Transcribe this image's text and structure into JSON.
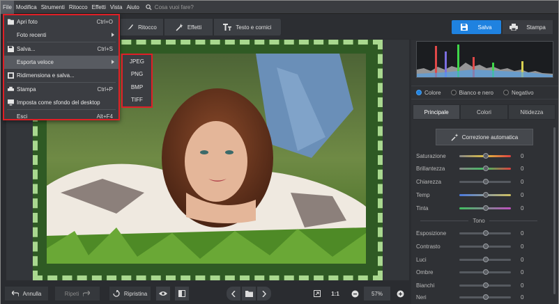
{
  "menubar": {
    "items": [
      "File",
      "Modifica",
      "Strumenti",
      "Ritocco",
      "Effetti",
      "Vista",
      "Aiuto"
    ],
    "search_placeholder": "Cosa vuoi fare?"
  },
  "toolbar": {
    "tabs": [
      "Ritocco",
      "Effetti",
      "Testo e cornici"
    ],
    "save_label": "Salva",
    "print_label": "Stampa"
  },
  "file_menu": {
    "items": [
      {
        "label": "Apri foto",
        "shortcut": "Ctrl+O",
        "icon": "folder-icon"
      },
      {
        "label": "Foto recenti",
        "shortcut": "",
        "submenu": true
      },
      {
        "label": "Salva...",
        "shortcut": "Ctrl+S",
        "icon": "save-icon"
      },
      {
        "label": "Esporta veloce",
        "shortcut": "",
        "submenu": true,
        "highlighted": true
      },
      {
        "label": "Ridimensiona e salva...",
        "shortcut": "",
        "icon": "resize-icon"
      },
      {
        "label": "Stampa",
        "shortcut": "Ctrl+P",
        "icon": "printer-icon"
      },
      {
        "label": "Imposta come sfondo del desktop",
        "shortcut": "",
        "icon": "monitor-icon"
      },
      {
        "label": "Esci",
        "shortcut": "Alt+F4"
      }
    ]
  },
  "export_submenu": {
    "items": [
      "JPEG",
      "PNG",
      "BMP",
      "TIFF"
    ]
  },
  "panel": {
    "radios": [
      {
        "label": "Colore",
        "selected": true
      },
      {
        "label": "Bianco e nero",
        "selected": false
      },
      {
        "label": "Negativo",
        "selected": false
      }
    ],
    "tabs": [
      "Principale",
      "Colori",
      "Nitidezza"
    ],
    "auto_label": "Correzione automatica",
    "sliders_color": [
      {
        "label": "Saturazione",
        "value": "0"
      },
      {
        "label": "Brillantezza",
        "value": "0"
      },
      {
        "label": "Chiarezza",
        "value": "0"
      },
      {
        "label": "Temp",
        "value": "0"
      },
      {
        "label": "Tinta",
        "value": "0"
      }
    ],
    "tone_title": "Tono",
    "sliders_tone": [
      {
        "label": "Esposizione",
        "value": "0"
      },
      {
        "label": "Contrasto",
        "value": "0"
      },
      {
        "label": "Luci",
        "value": "0"
      },
      {
        "label": "Ombre",
        "value": "0"
      },
      {
        "label": "Bianchi",
        "value": "0"
      },
      {
        "label": "Neri",
        "value": "0"
      }
    ]
  },
  "bottombar": {
    "undo": "Annulla",
    "redo": "Ripeti",
    "reset": "Ripristina",
    "ratio": "1:1",
    "zoom": "57%"
  },
  "colors": {
    "accent": "#1f82e0",
    "highlight_border": "#e01f26",
    "frame_green": "#2f5a24",
    "frame_dash": "#a9d88f"
  }
}
